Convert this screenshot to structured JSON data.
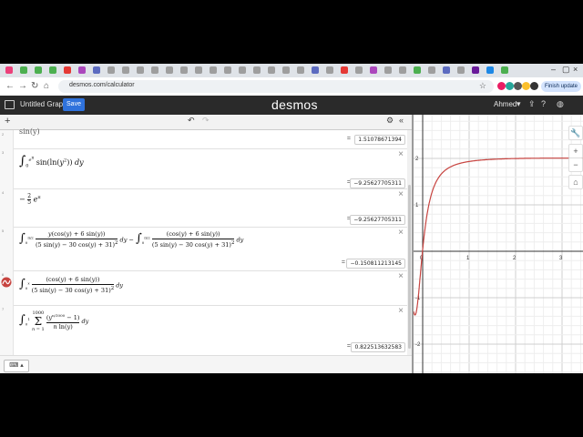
{
  "browser": {
    "url": "desmos.com/calculator",
    "finish_update": "Finish update",
    "tab_colors": [
      "#ec407a",
      "#4caf50",
      "#4caf50",
      "#4caf50",
      "#e53935",
      "#ab47bc",
      "#5c6bc0",
      "#9e9e9e",
      "#9e9e9e",
      "#9e9e9e",
      "#9e9e9e",
      "#9e9e9e",
      "#9e9e9e",
      "#9e9e9e",
      "#9e9e9e",
      "#9e9e9e",
      "#9e9e9e",
      "#9e9e9e",
      "#9e9e9e",
      "#9e9e9e",
      "#9e9e9e",
      "#5c6bc0",
      "#9e9e9e",
      "#e53935",
      "#9e9e9e",
      "#ab47bc",
      "#9e9e9e",
      "#9e9e9e",
      "#4caf50",
      "#9e9e9e",
      "#5c6bc0",
      "#9e9e9e",
      "#6a1b9a",
      "#1e88e5",
      "#4caf50"
    ],
    "extension_colors": [
      "#e91e63",
      "#26a69a",
      "#555555",
      "#fbc02d",
      "#333333"
    ]
  },
  "header": {
    "title": "Untitled Graph",
    "save_label": "Save",
    "logo": "desmos",
    "user": "Ahmed"
  },
  "expressions": [
    {
      "index": "2",
      "partial": "…",
      "result": "1.51078671394"
    },
    {
      "index": "3",
      "latex": "∫₀^{e^π} sin(ln(y²)) dy",
      "result": "−9.25627705311"
    },
    {
      "index": "4",
      "latex": "−(2/5) e^π",
      "result": "−9.25627705311"
    },
    {
      "index": "5",
      "latex": "∫₀^{π/2} y(cos(y)+6 sin(y)) / (5 sin(y)−30 cos(y)+31)² dy − ∫₀^{π/2} (cos(y)+6 sin(y)) / (5 sin(y)−30 cos(y)+31)² dy",
      "result": "−0.150811213145"
    },
    {
      "index": "6",
      "latex": "∫₀^x (cos(y)+6 sin(y)) / (5 sin(y)−30 cos(y)+31)² dy"
    },
    {
      "index": "7",
      "latex": "∫₀^1 Σ_{n=1}^{1000} (y^{n/1000} − 1)/(n ln(y)) dy",
      "result": "0.822513632583"
    }
  ],
  "graph": {
    "x_ticks": [
      "0",
      "1",
      "2",
      "3"
    ],
    "y_ticks": [
      "2",
      "1",
      "-1",
      "-2",
      "-3"
    ],
    "curve_color": "#c74440"
  },
  "labels": {
    "eq": "=",
    "dy": "dy",
    "keyboard": "⌨ ▴"
  }
}
